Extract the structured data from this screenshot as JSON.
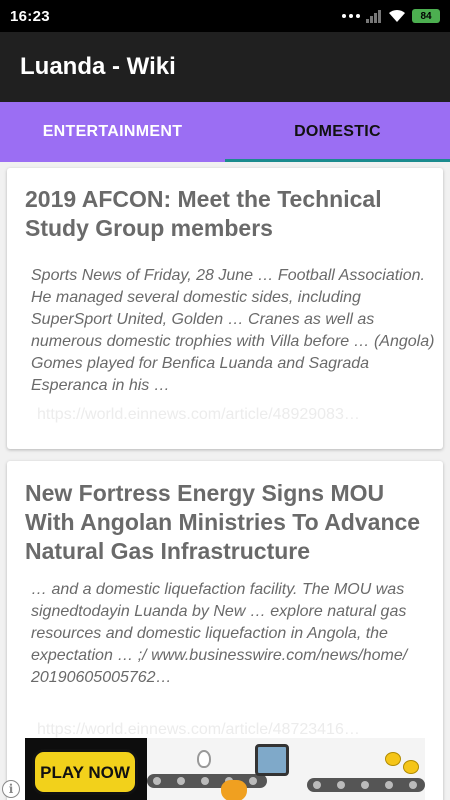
{
  "status_bar": {
    "time": "16:23",
    "battery": "84",
    "icons": [
      "more-dots-icon",
      "signal-icon",
      "wifi-icon",
      "battery-icon"
    ]
  },
  "app_bar": {
    "title": "Luanda - Wiki"
  },
  "tabs": [
    {
      "label": "ENTERTAINMENT",
      "selected": false
    },
    {
      "label": "DOMESTIC",
      "selected": true
    }
  ],
  "colors": {
    "tab_bar": "#9b6ef3",
    "app_bar": "#202020",
    "tab_indicator": "#1b8b8e",
    "ad_button": "#f2d11b"
  },
  "articles": [
    {
      "title": "2019 AFCON: Meet the Technical Study Group members",
      "snippet": "Sports News of Friday, 28 June … Football Association. He managed several domestic sides, including SuperSport United, Golden … Cranes as well as numerous domestic trophies with Villa before … (Angola) Gomes played for Benfica Luanda and Sagrada Esperanca in his …",
      "link": "https://world.einnews.com/article/48929083…"
    },
    {
      "title": "New Fortress Energy Signs MOU With Angolan Ministries To Advance Natural Gas Infrastructure",
      "snippet": "… and a domestic liquefaction facility. The MOU was signedtodayin Luanda by New … explore natural gas resources and domestic liquefaction in Angola, the expectation … ;/ www.businesswire.com/news/home/ 20190605005762…",
      "link": "https://world.einnews.com/article/48723416…"
    }
  ],
  "ad": {
    "button_label": "PLAY NOW"
  }
}
